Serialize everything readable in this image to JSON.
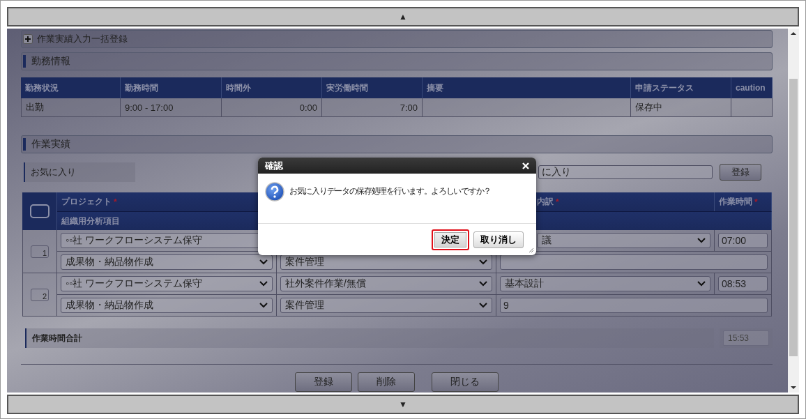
{
  "scroll_up": "▲",
  "scroll_down": "▼",
  "bulk_panel": {
    "label": "作業実績入力一括登録",
    "expanded": false
  },
  "attendance": {
    "title": "勤務情報",
    "columns": [
      "勤務状況",
      "勤務時間",
      "時間外",
      "実労働時間",
      "摘要",
      "申請ステータス",
      "caution"
    ],
    "rows": [
      {
        "cells": [
          "出勤",
          "9:00 - 17:00",
          "0:00",
          "7:00",
          null,
          "保存中",
          null
        ]
      }
    ]
  },
  "work": {
    "title": "作業実績",
    "favorite": {
      "label": "お気に入り",
      "value": "に入り",
      "button": "登録"
    },
    "select_all": {
      "checked": false
    },
    "columns": [
      {
        "label": "プロジェクト",
        "marker": "*"
      },
      {
        "label": "内訳",
        "marker": "*"
      },
      {
        "label": "作業時間",
        "marker": "*"
      }
    ],
    "subheader": "組織用分析項目",
    "rows": [
      {
        "number": "1",
        "project": "◦◦社 ワークフローシステム保守",
        "category": null,
        "detail": "議",
        "time": "07:00",
        "analysis": "成果物・納品物作成",
        "management": "案件管理",
        "note": null
      },
      {
        "number": "2",
        "project": "◦◦社 ワークフローシステム保守",
        "category": "社外案件作業/無償",
        "detail": "基本設計",
        "time": "08:53",
        "analysis": "成果物・納品物作成",
        "management": "案件管理",
        "note": "9"
      }
    ]
  },
  "total": {
    "label": "作業時間合計",
    "value": "15:53"
  },
  "buttons": [
    {
      "label": "登録"
    },
    {
      "label": "削除"
    },
    {
      "label": "閉じる"
    }
  ],
  "dialog": {
    "title": "確認",
    "message": "お気に入りデータの保存処理を行います。よろしいですか？",
    "buttons": [
      {
        "label": "決定",
        "focused": true
      },
      {
        "label": "取り消し",
        "focused": false
      }
    ]
  }
}
